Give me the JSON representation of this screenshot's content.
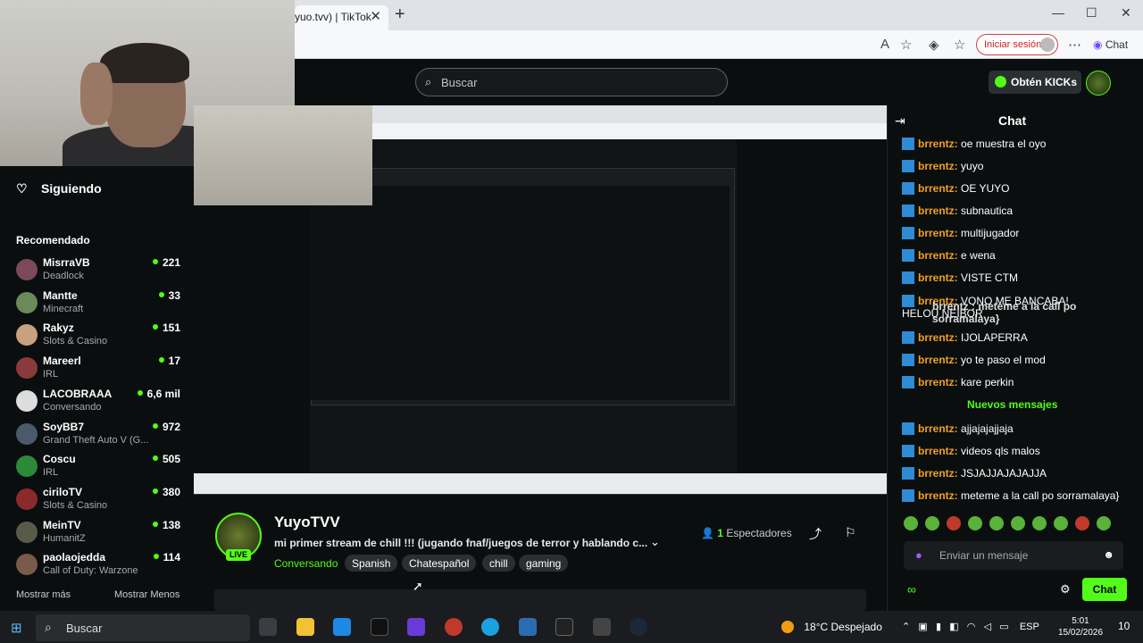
{
  "browser": {
    "tab_title": "yuo.tvv) | TikTok",
    "signin_label": "Iniciar sesión",
    "copilot_label": "Chat"
  },
  "kick": {
    "search_placeholder": "Buscar",
    "get_kicks": "Obtén KICKs"
  },
  "sidebar": {
    "following_label": "Siguiendo",
    "recommended_label": "Recomendado",
    "channels": [
      {
        "name": "MisrraVB",
        "category": "Deadlock",
        "viewers": "221"
      },
      {
        "name": "Mantte",
        "category": "Minecraft",
        "viewers": "33"
      },
      {
        "name": "Rakyz",
        "category": "Slots & Casino",
        "viewers": "151"
      },
      {
        "name": "Mareerl",
        "category": "IRL",
        "viewers": "17"
      },
      {
        "name": "LACOBRAAA",
        "category": "Conversando",
        "viewers": "6,6 mil"
      },
      {
        "name": "SoyBB7",
        "category": "Grand Theft Auto V (G...",
        "viewers": "972"
      },
      {
        "name": "Coscu",
        "category": "IRL",
        "viewers": "505"
      },
      {
        "name": "ciriloTV",
        "category": "Slots & Casino",
        "viewers": "380"
      },
      {
        "name": "MeinTV",
        "category": "HumanitZ",
        "viewers": "138"
      },
      {
        "name": "paolaojedda",
        "category": "Call of Duty: Warzone",
        "viewers": "114"
      }
    ],
    "show_more": "Mostrar más",
    "show_less": "Mostrar Menos"
  },
  "stream": {
    "channel_name": "YuyoTVV",
    "live_badge": "LIVE",
    "title": "mi primer stream de chill !!! (jugando fnaf/juegos de terror y hablando c...",
    "category": "Conversando",
    "tags": [
      "Spanish",
      "Chatespañol",
      "chill",
      "gaming"
    ],
    "viewers_count": "1",
    "viewers_label": "Espectadores"
  },
  "chat": {
    "title": "Chat",
    "messages_before": [
      {
        "user": "brrentz",
        "text": "oe muestra el oyo"
      },
      {
        "user": "brrentz",
        "text": "yuyo"
      },
      {
        "user": "brrentz",
        "text": "OE YUYO"
      },
      {
        "user": "brrentz",
        "text": "subnautica"
      },
      {
        "user": "brrentz",
        "text": "multijugador"
      },
      {
        "user": "brrentz",
        "text": "e wena"
      },
      {
        "user": "brrentz",
        "text": "VISTE CTM"
      },
      {
        "user": "brrentz",
        "text": "VONO ME BANCABA! HELOU NEIBOR"
      },
      {
        "user": "brrentz",
        "text": "IJOLAPERRA"
      },
      {
        "user": "brrentz",
        "text": "yo te paso el mod"
      },
      {
        "user": "brrentz",
        "text": "kare perkin"
      }
    ],
    "new_messages_label": "Nuevos mensajes",
    "messages_after": [
      {
        "user": "brrentz",
        "text": "ajjajajajjaja"
      },
      {
        "user": "brrentz",
        "text": "videos qls malos"
      },
      {
        "user": "brrentz",
        "text": "JSJAJJAJAJAJJA"
      },
      {
        "user": "brrentz",
        "text": "meteme a la call po sorramalaya}"
      }
    ],
    "overlay_text": "brrentz : meteme a la call po sorramalaya}",
    "input_placeholder": "Enviar un mensaje",
    "send_label": "Chat"
  },
  "taskbar": {
    "search_label": "Buscar",
    "weather": "18°C  Despejado",
    "lang": "ESP",
    "time": "5:01",
    "date": "15/02/2026",
    "notif_count": "10"
  },
  "colors": {
    "kick_green": "#53fc18",
    "username": "#f0a020",
    "background": "#0b0e0f"
  }
}
